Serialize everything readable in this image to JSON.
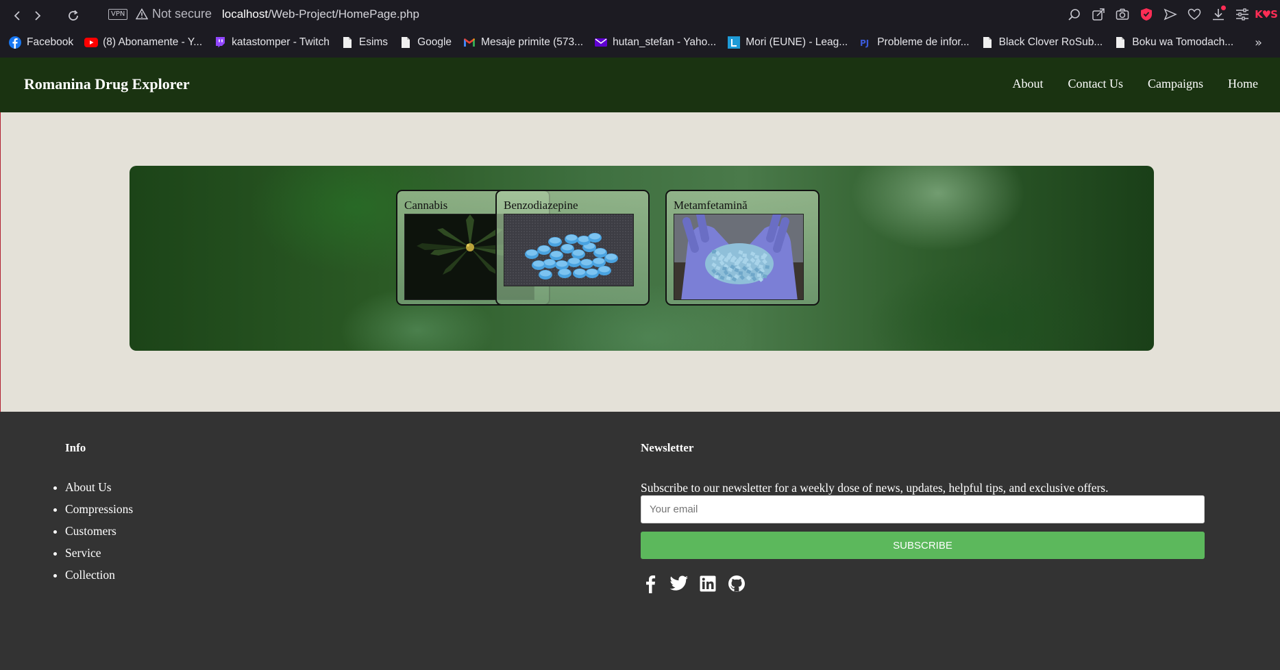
{
  "browser": {
    "vpn_label": "VPN",
    "security_text": "Not secure",
    "url_host": "localhost",
    "url_path": "/Web-Project/HomePage.php",
    "bookmarks": [
      {
        "label": "Facebook",
        "icon": "facebook-icon"
      },
      {
        "label": "(8) Abonamente - Y...",
        "icon": "youtube-icon"
      },
      {
        "label": "katastomper - Twitch",
        "icon": "twitch-icon"
      },
      {
        "label": "Esims",
        "icon": "page-icon"
      },
      {
        "label": "Google",
        "icon": "page-icon"
      },
      {
        "label": "Mesaje primite (573...",
        "icon": "gmail-icon"
      },
      {
        "label": "hutan_stefan - Yaho...",
        "icon": "yahoo-mail-icon"
      },
      {
        "label": "Mori (EUNE) - Leag...",
        "icon": "league-icon"
      },
      {
        "label": "Probleme de infor...",
        "icon": "pb-icon"
      },
      {
        "label": "Black Clover RoSub...",
        "icon": "page-icon"
      },
      {
        "label": "Boku wa Tomodach...",
        "icon": "page-icon"
      }
    ],
    "more_label": "»",
    "logo_text": "K♥S"
  },
  "header": {
    "title": "Romanina Drug Explorer",
    "nav": [
      "About",
      "Contact Us",
      "Campaigns",
      "Home"
    ]
  },
  "cards": [
    {
      "label": "Cannabis",
      "image": "cannabis-leaf-image"
    },
    {
      "label": "Benzodiazepine",
      "image": "blue-pills-image"
    },
    {
      "label": "Metamfetamină",
      "image": "gloved-hands-crystals-image"
    }
  ],
  "footer": {
    "info_heading": "Info",
    "info_links": [
      "About Us",
      "Compressions",
      "Customers",
      "Service",
      "Collection"
    ],
    "newsletter_heading": "Newsletter",
    "newsletter_text": "Subscribe to our newsletter for a weekly dose of news, updates, helpful tips, and exclusive offers.",
    "email_placeholder": "Your email",
    "subscribe_label": "SUBSCRIBE",
    "social": [
      "facebook-icon",
      "twitter-icon",
      "linkedin-icon",
      "github-icon"
    ]
  },
  "colors": {
    "header_bg": "#1a3311",
    "main_bg": "#e4e1d8",
    "footer_bg": "#333333",
    "subscribe_green": "#5cb85c",
    "browser_bg": "#1c1b22"
  }
}
